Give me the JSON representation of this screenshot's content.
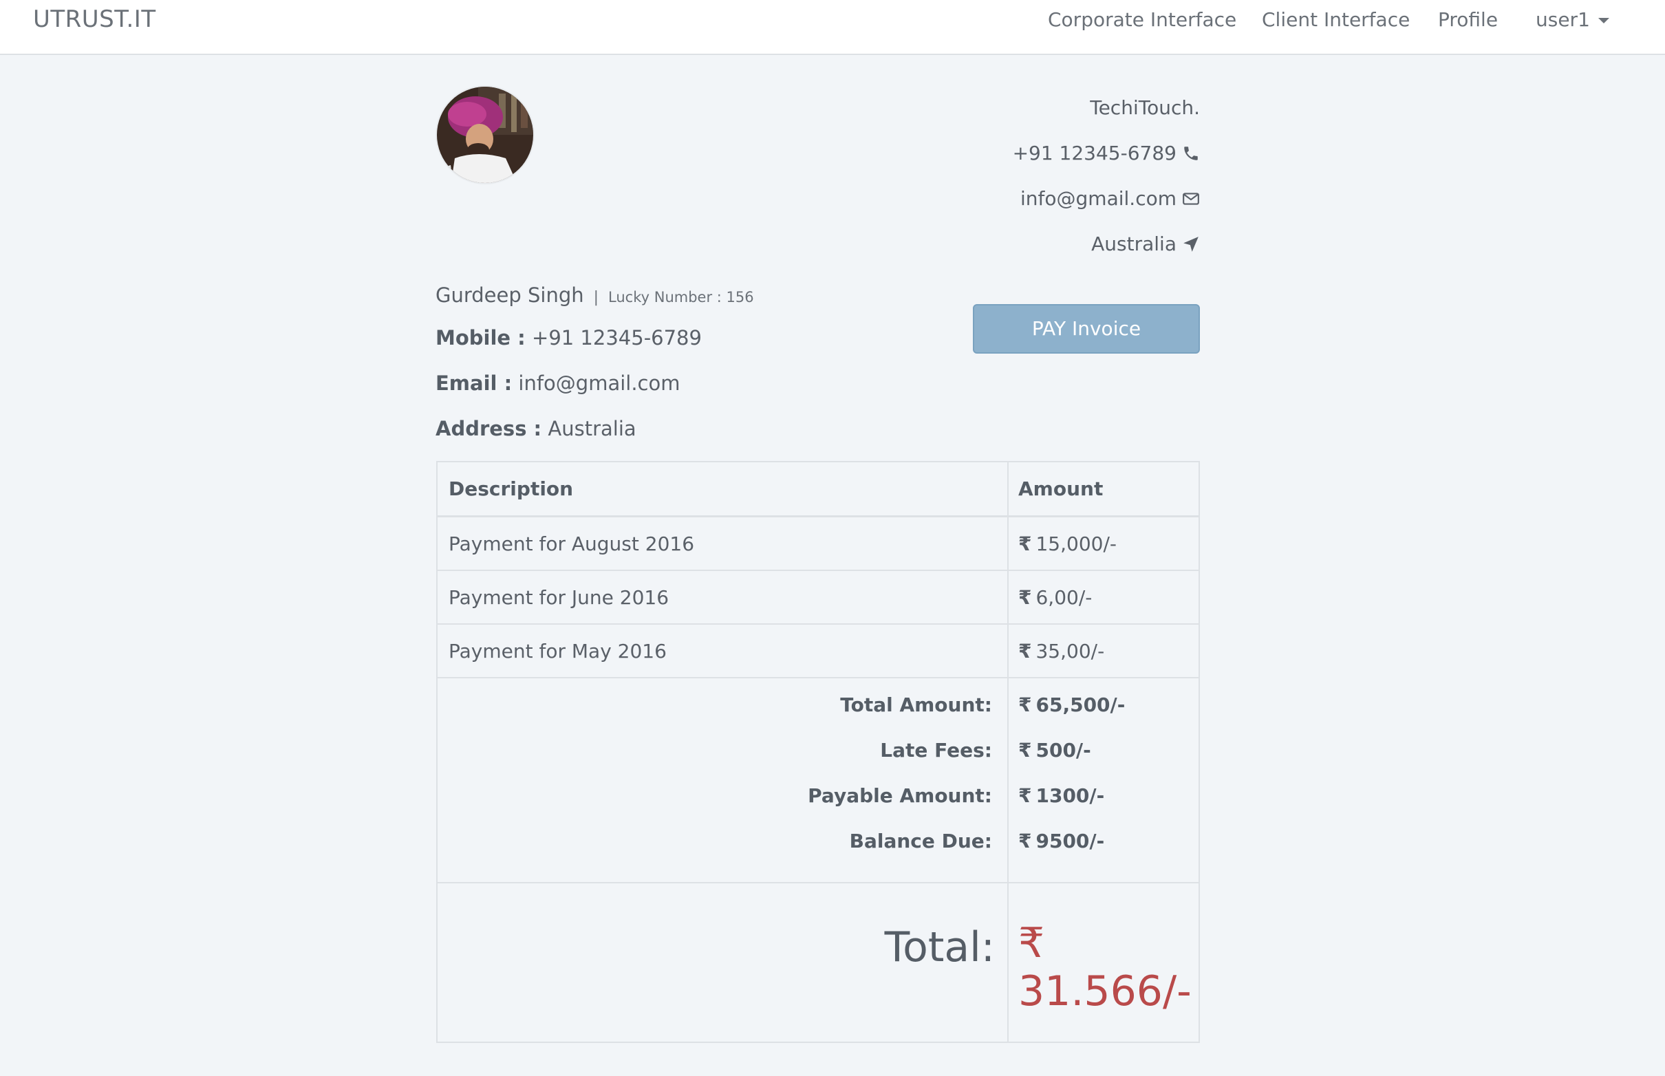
{
  "navbar": {
    "brand": "UTRUST.IT",
    "links": [
      "Corporate Interface",
      "Client Interface",
      "Profile"
    ],
    "user": "user1"
  },
  "company": {
    "name": "TechiTouch.",
    "phone": "+91 12345-6789",
    "email": "info@gmail.com",
    "location": "Australia"
  },
  "client": {
    "name": "Gurdeep Singh",
    "separator": "|",
    "lucky_number": "Lucky Number : 156",
    "mobile_label": "Mobile :",
    "mobile": "+91 12345-6789",
    "email_label": "Email :",
    "email": "info@gmail.com",
    "address_label": "Address :",
    "address": "Australia"
  },
  "pay_button": "PAY Invoice",
  "table": {
    "headers": [
      "Description",
      "Amount"
    ],
    "rows": [
      {
        "description": "Payment for August 2016",
        "amount": "15,000/-"
      },
      {
        "description": "Payment for June 2016",
        "amount": "6,00/-"
      },
      {
        "description": "Payment for May 2016",
        "amount": "35,00/-"
      }
    ],
    "currency_symbol": "₹",
    "summary": [
      {
        "label": "Total Amount:",
        "value": "65,500/-"
      },
      {
        "label": "Late Fees:",
        "value": "500/-"
      },
      {
        "label": "Payable Amount:",
        "value": "1300/-"
      },
      {
        "label": "Balance Due:",
        "value": "9500/-"
      }
    ],
    "total_label": "Total:",
    "total_value": "₹ 31.566/-"
  },
  "icons": {
    "phone": "phone-icon",
    "email": "envelope-icon",
    "location": "location-arrow-icon",
    "user_menu": "caret-down-icon"
  },
  "colors": {
    "button": "#8db1cc",
    "total": "#b94a4a",
    "background": "#f2f5f8"
  }
}
